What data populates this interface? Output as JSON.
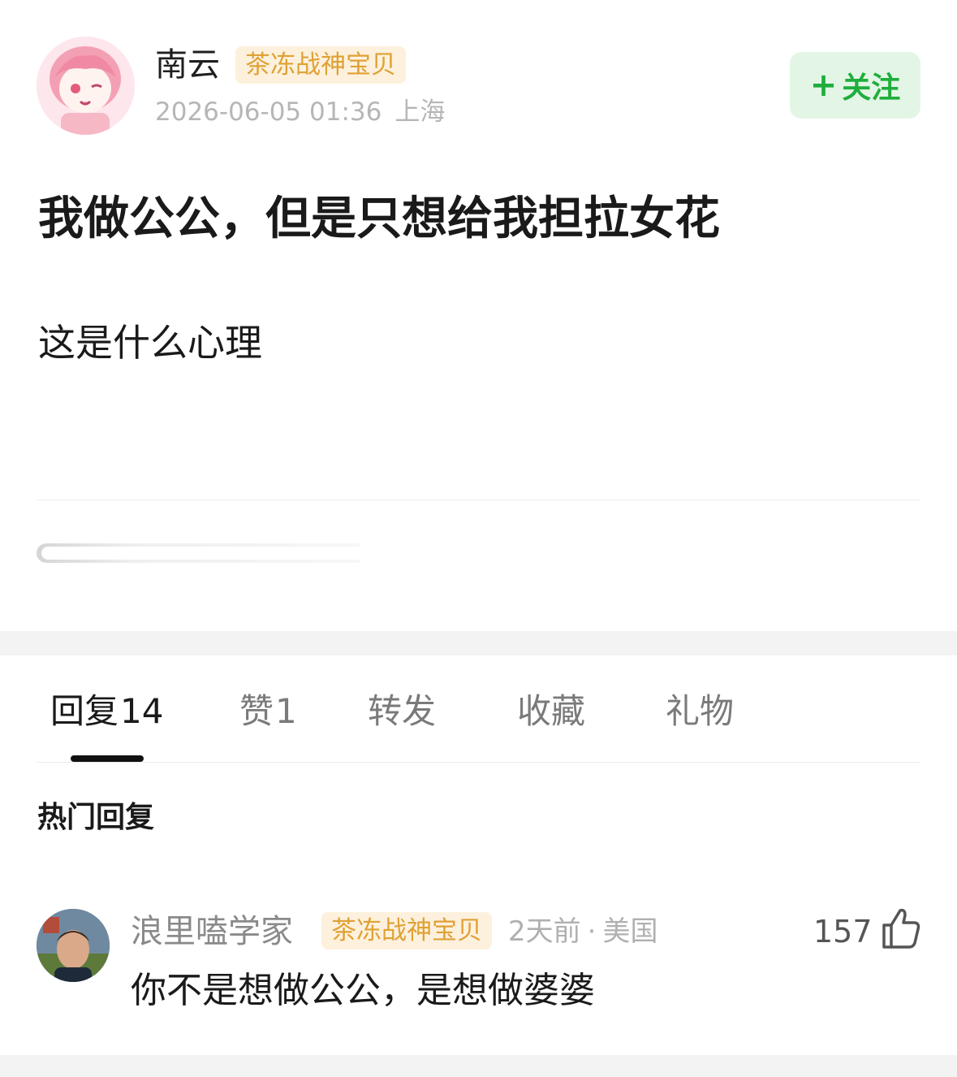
{
  "post": {
    "author": {
      "name": "南云",
      "badge": "茶冻战神宝贝",
      "avatar_icon": "anime-girl-avatar"
    },
    "date": "2026-06-05 01:36",
    "location": "上海",
    "follow_label": "关注",
    "follow_plus": "+",
    "title": "我做公公，但是只想给我担拉女花",
    "body": "这是什么心理"
  },
  "tabs": [
    {
      "label": "回复",
      "count": "14",
      "active": true
    },
    {
      "label": "赞",
      "count": "1",
      "active": false
    },
    {
      "label": "转发",
      "count": "",
      "active": false
    },
    {
      "label": "收藏",
      "count": "",
      "active": false
    },
    {
      "label": "礼物",
      "count": "",
      "active": false
    }
  ],
  "hot_replies_title": "热门回复",
  "comment": {
    "name": "浪里嗑学家",
    "badge": "茶冻战神宝贝",
    "time": "2天前",
    "separator": "·",
    "location": "美国",
    "likes": "157",
    "text": "你不是想做公公，是想做婆婆",
    "avatar_icon": "man-photo-avatar"
  },
  "colors": {
    "accent_green": "#1fae3c",
    "follow_bg": "#e3f6e6",
    "badge_text": "#e0a135",
    "badge_bg": "#fdf1dd",
    "section_bg": "#f3f3f3"
  }
}
